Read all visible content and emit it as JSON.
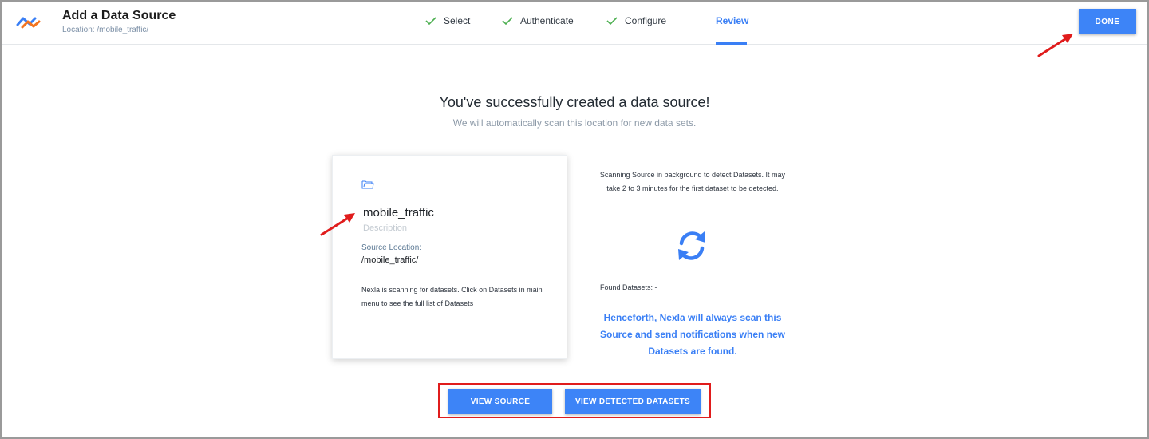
{
  "header": {
    "title": "Add a Data Source",
    "location": "Location: /mobile_traffic/",
    "done_label": "DONE"
  },
  "steps": [
    {
      "label": "Select",
      "state": "complete"
    },
    {
      "label": "Authenticate",
      "state": "complete"
    },
    {
      "label": "Configure",
      "state": "complete"
    },
    {
      "label": "Review",
      "state": "active"
    }
  ],
  "main": {
    "heading": "You've successfully created a data source!",
    "subheading": "We will automatically scan this location for new data sets."
  },
  "card": {
    "icon": "folder-icon",
    "name": "mobile_traffic",
    "description_placeholder": "Description",
    "location_label": "Source Location:",
    "location_value": "/mobile_traffic/",
    "message": "Nexla is scanning for datasets. Click on Datasets in main menu to see the full list of Datasets"
  },
  "scan": {
    "text": "Scanning Source in background to detect Datasets. It may take 2 to 3 minutes for the first dataset to be detected.",
    "icon": "refresh-icon",
    "found_label": "Found Datasets: -",
    "henceforth": "Henceforth, Nexla will always scan this Source and send notifications when new Datasets are found."
  },
  "actions": {
    "view_source": "VIEW SOURCE",
    "view_datasets": "VIEW DETECTED DATASETS"
  },
  "colors": {
    "accent": "#3a7ff5",
    "button": "#3d84f7",
    "check": "#4caf50",
    "annotation": "#e01c1c"
  }
}
